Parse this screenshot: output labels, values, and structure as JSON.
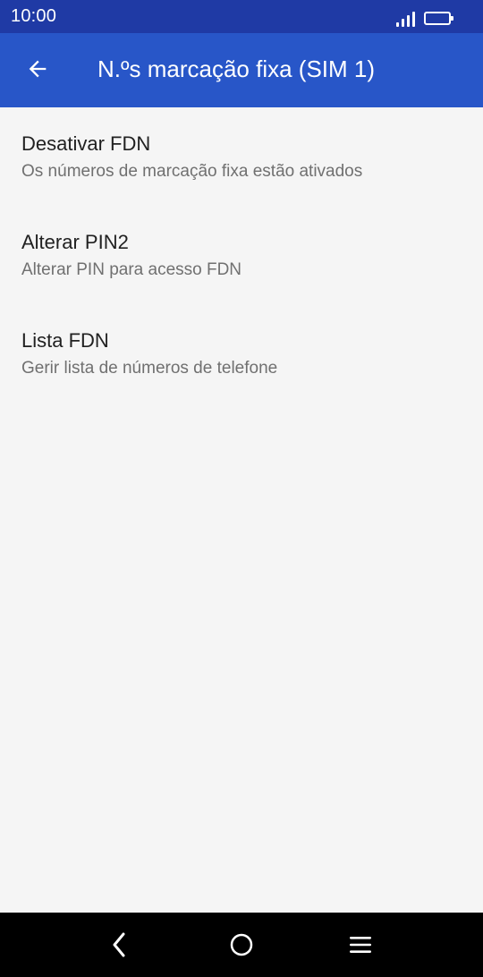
{
  "status_bar": {
    "time": "10:00",
    "signal_icon": "cellular-signal-icon",
    "battery_icon": "battery-icon"
  },
  "app_bar": {
    "title": "N.ºs marcação fixa (SIM 1)",
    "back_icon": "arrow-back-icon"
  },
  "items": [
    {
      "title": "Desativar FDN",
      "subtitle": "Os números de marcação fixa estão ativados"
    },
    {
      "title": "Alterar PIN2",
      "subtitle": "Alterar PIN para acesso FDN"
    },
    {
      "title": "Lista FDN",
      "subtitle": "Gerir lista de números de telefone"
    }
  ],
  "nav_bar": {
    "back_icon": "nav-back-icon",
    "home_icon": "nav-home-icon",
    "menu_icon": "nav-menu-icon"
  },
  "colors": {
    "status_bar": "#1f3aa5",
    "app_bar": "#2856c8",
    "background": "#f5f5f5",
    "title_text": "#212121",
    "subtitle_text": "#707070",
    "nav_bar": "#000000"
  }
}
